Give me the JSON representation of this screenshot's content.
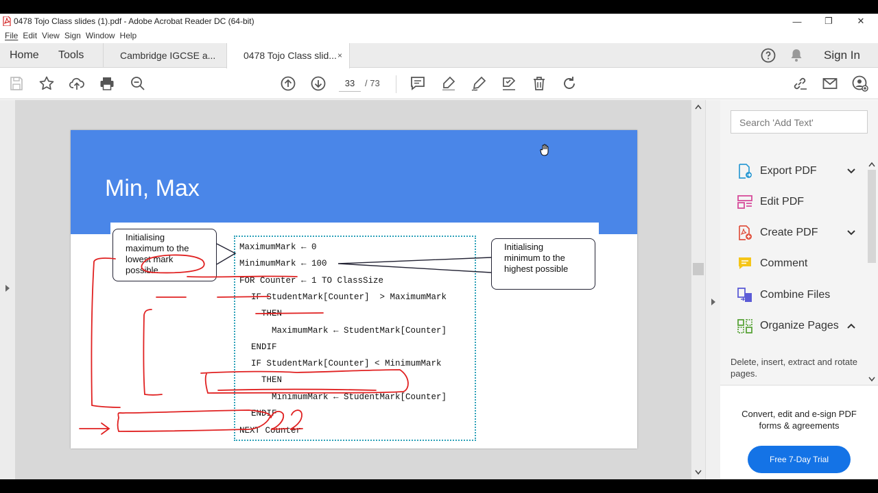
{
  "window": {
    "title": "0478 Tojo Class slides (1).pdf - Adobe Acrobat Reader DC (64-bit)",
    "minimize": "—",
    "restore": "❐",
    "close": "✕"
  },
  "menu": [
    "File",
    "Edit",
    "View",
    "Sign",
    "Window",
    "Help"
  ],
  "tabs": {
    "home": "Home",
    "tools": "Tools",
    "doc_tabs": [
      {
        "label": "Cambridge IGCSE a..."
      },
      {
        "label": "0478 Tojo Class slid...",
        "close": "×"
      }
    ],
    "sign_in": "Sign In"
  },
  "toolbar": {
    "page_current": "33",
    "page_total": "/ 73"
  },
  "slide": {
    "title": "Min, Max",
    "callout_left": [
      "Initialising",
      "maximum to the",
      "lowest mark",
      "possible"
    ],
    "callout_right": [
      "Initialising",
      "minimum to the",
      "highest possible"
    ],
    "code": [
      "MaximumMark ← 0",
      "MinimumMark ← 100",
      "FOR Counter ← 1 TO ClassSize",
      "  IF StudentMark[Counter]  > MaximumMark",
      "    THEN",
      "      MaximumMark ← StudentMark[Counter]",
      "  ENDIF",
      "  IF StudentMark[Counter] < MinimumMark",
      "    THEN",
      "      MinimumMark ← StudentMark[Counter]",
      "  ENDIF",
      "NEXT Counter"
    ]
  },
  "side_panel": {
    "search_placeholder": "Search 'Add Text'",
    "tools": [
      {
        "label": "Export PDF",
        "icon": "export-pdf-icon",
        "chevron": "down"
      },
      {
        "label": "Edit PDF",
        "icon": "edit-pdf-icon"
      },
      {
        "label": "Create PDF",
        "icon": "create-pdf-icon",
        "chevron": "down"
      },
      {
        "label": "Comment",
        "icon": "comment-icon"
      },
      {
        "label": "Combine Files",
        "icon": "combine-files-icon"
      },
      {
        "label": "Organize Pages",
        "icon": "organize-pages-icon",
        "chevron": "up"
      }
    ],
    "organize_desc": "Delete, insert, extract and rotate pages.",
    "promo_text": "Convert, edit and e-sign PDF forms & agreements",
    "trial_button": "Free 7-Day Trial"
  },
  "colors": {
    "slide_header": "#4a86e8",
    "annotation_red": "#e02020",
    "code_border": "#2aa0b8",
    "trial_button": "#1473e6"
  }
}
